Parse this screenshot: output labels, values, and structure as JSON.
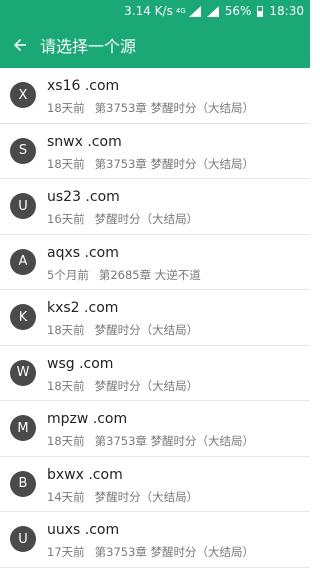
{
  "status_bar": {
    "speed": "3.14 K/s",
    "network": "4G",
    "battery": "56%",
    "time": "18:30"
  },
  "app_bar": {
    "back_icon": "arrow-left-icon",
    "title": "请选择一个源"
  },
  "sources": [
    {
      "letter": "X",
      "name": "xs16 .com",
      "time": "18天前",
      "chapter": "第3753章 梦醒时分（大结局）"
    },
    {
      "letter": "S",
      "name": "snwx .com",
      "time": "18天前",
      "chapter": "第3753章 梦醒时分（大结局）"
    },
    {
      "letter": "U",
      "name": "us23 .com",
      "time": "16天前",
      "chapter": "梦醒时分（大结局）"
    },
    {
      "letter": "A",
      "name": "aqxs .com",
      "time": "5个月前",
      "chapter": "第2685章 大逆不道"
    },
    {
      "letter": "K",
      "name": "kxs2 .com",
      "time": "18天前",
      "chapter": "梦醒时分（大结局）"
    },
    {
      "letter": "W",
      "name": "wsg .com",
      "time": "18天前",
      "chapter": "梦醒时分（大结局）"
    },
    {
      "letter": "M",
      "name": "mpzw .com",
      "time": "18天前",
      "chapter": "第3753章 梦醒时分（大结局）"
    },
    {
      "letter": "B",
      "name": "bxwx .com",
      "time": "14天前",
      "chapter": "梦醒时分（大结局）"
    },
    {
      "letter": "U",
      "name": "uuxs .com",
      "time": "17天前",
      "chapter": "第3753章 梦醒时分（大结局）"
    }
  ]
}
